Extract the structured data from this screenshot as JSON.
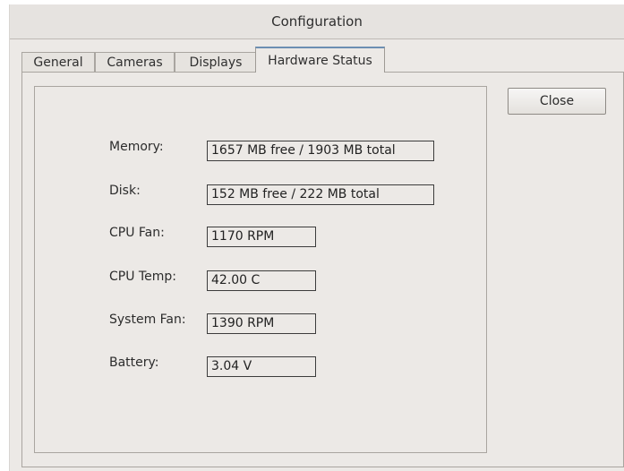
{
  "window": {
    "title": "Configuration"
  },
  "tabs": [
    {
      "label": "General",
      "active": false
    },
    {
      "label": "Cameras",
      "active": false
    },
    {
      "label": "Displays",
      "active": false
    },
    {
      "label": "Hardware Status",
      "active": true
    }
  ],
  "hardware_status": {
    "memory": {
      "label": "Memory:",
      "value": "1657 MB free / 1903 MB total"
    },
    "disk": {
      "label": "Disk:",
      "value": "152 MB free / 222 MB total"
    },
    "cpu_fan": {
      "label": "CPU Fan:",
      "value": "1170 RPM"
    },
    "cpu_temp": {
      "label": "CPU Temp:",
      "value": "42.00 C"
    },
    "system_fan": {
      "label": "System Fan:",
      "value": "1390 RPM"
    },
    "battery": {
      "label": "Battery:",
      "value": "3.04 V"
    }
  },
  "buttons": {
    "close_label": "Close"
  }
}
